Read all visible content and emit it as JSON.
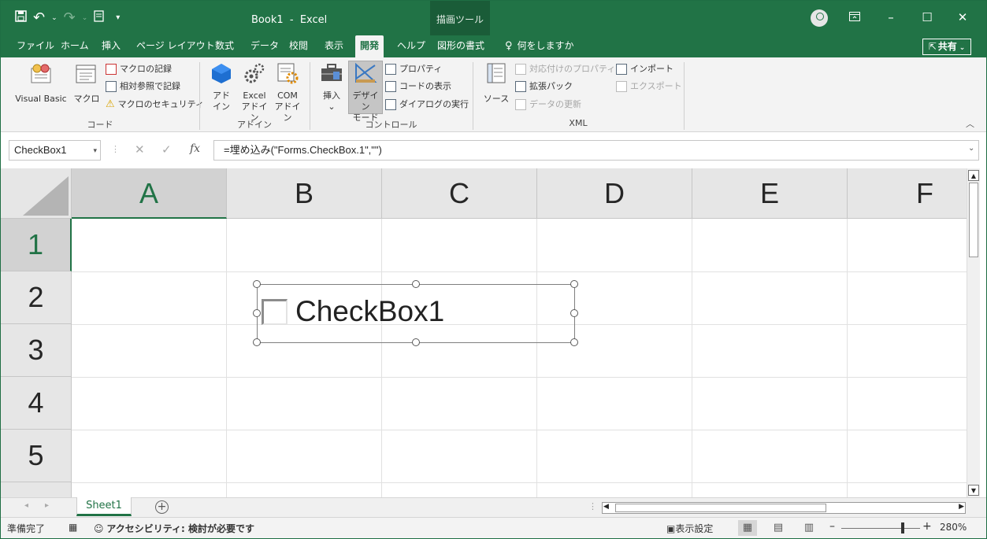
{
  "titlebar": {
    "title": "Book1  -  Excel",
    "context_tab": "描画ツール",
    "qat_customize": "▾"
  },
  "tabs": [
    {
      "label": "ファイル"
    },
    {
      "label": "ホーム"
    },
    {
      "label": "挿入"
    },
    {
      "label": "ページ レイアウト"
    },
    {
      "label": "数式"
    },
    {
      "label": "データ"
    },
    {
      "label": "校閲"
    },
    {
      "label": "表示"
    },
    {
      "label": "開発",
      "active": true
    },
    {
      "label": "ヘルプ"
    },
    {
      "label": "図形の書式"
    }
  ],
  "tell_me": "何をしますか",
  "share": "共有",
  "ribbon": {
    "code": {
      "title": "コード",
      "visual_basic": "Visual Basic",
      "macro": "マクロ",
      "record_macro": "マクロの記録",
      "relative_ref": "相対参照で記録",
      "macro_security": "マクロのセキュリティ"
    },
    "addins": {
      "title": "アドイン",
      "addin_1": "アド",
      "addin_2": "イン",
      "excel_addin_1": "Excel",
      "excel_addin_2": "アドイン",
      "com_addin_1": "COM",
      "com_addin_2": "アドイン"
    },
    "controls": {
      "title": "コントロール",
      "insert": "挿入",
      "design_mode_1": "デザイン",
      "design_mode_2": "モード",
      "properties": "プロパティ",
      "view_code": "コードの表示",
      "run_dialog": "ダイアログの実行"
    },
    "xml": {
      "title": "XML",
      "source": "ソース",
      "map_properties": "対応付けのプロパティ",
      "expansion_packs": "拡張パック",
      "refresh_data": "データの更新",
      "import": "インポート",
      "export": "エクスポート"
    }
  },
  "formula_bar": {
    "name_box": "CheckBox1",
    "fx": "fx",
    "formula": "=埋め込み(\"Forms.CheckBox.1\",\"\")"
  },
  "grid": {
    "columns": [
      "A",
      "B",
      "C",
      "D",
      "E",
      "F"
    ],
    "rows": [
      "1",
      "2",
      "3",
      "4",
      "5"
    ],
    "selected_column": "A",
    "selected_row": "1"
  },
  "checkbox_control": {
    "label": "CheckBox1",
    "checked": false
  },
  "sheets": [
    {
      "name": "Sheet1",
      "active": true
    }
  ],
  "status": {
    "ready": "準備完了",
    "accessibility": "アクセシビリティ: 検討が必要です",
    "display_settings": "表示設定",
    "zoom": "280%"
  },
  "colors": {
    "excel_green": "#217346",
    "ribbon_bg": "#f3f3f3"
  }
}
